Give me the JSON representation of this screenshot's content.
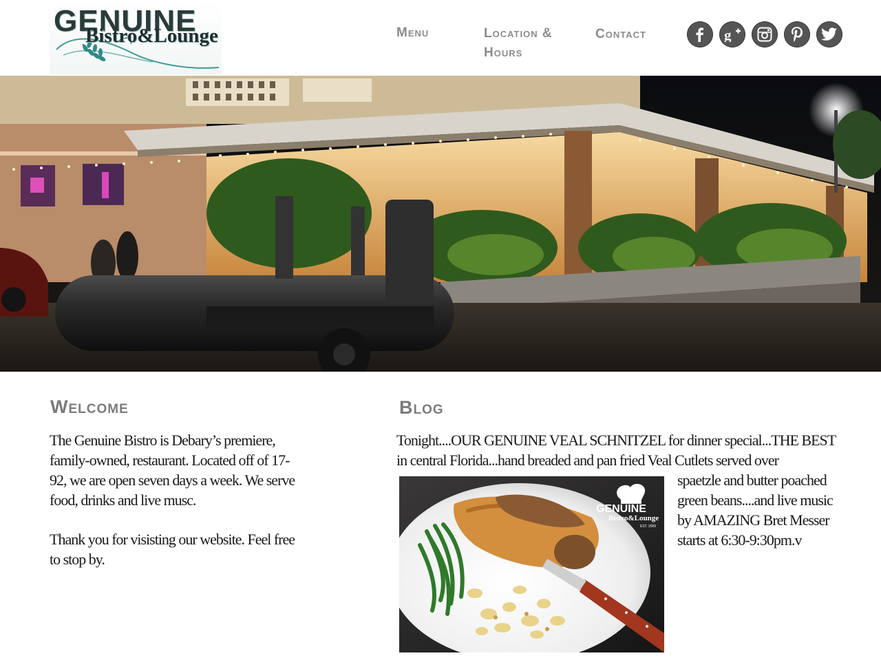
{
  "brand": {
    "logo_word1": "GENUINE",
    "logo_word2": "Bistro&Lounge",
    "accent_teal": "#2f8a86",
    "dark_teal": "#1f2f2f"
  },
  "nav": {
    "menu": "Menu",
    "location": "Location & Hours",
    "contact": "Contact"
  },
  "social": [
    {
      "icon": "facebook-icon"
    },
    {
      "icon": "google-plus-icon"
    },
    {
      "icon": "instagram-icon"
    },
    {
      "icon": "pinterest-icon"
    },
    {
      "icon": "twitter-icon"
    }
  ],
  "welcome": {
    "title": "Welcome",
    "p1": "The Genuine Bistro is Debary’s premiere, family-owned, restaurant. Located off of 17-92, we are open seven days a week. We serve food, drinks and live musc.",
    "p2": "Thank you for visisting our website. Feel free to stop by."
  },
  "blog": {
    "title": "Blog",
    "intro": "Tonight....OUR GENUINE VEAL SCHNITZEL for dinner special...THE BEST in central Florida...hand breaded and pan fried Veal Cutlets served over",
    "side": "spaetzle and butter poached green beans....and live music by AMAZING Bret Messer starts at 6:30-9:30pm.v",
    "photo_logo_word1": "GENUINE",
    "photo_logo_word2": "Bistro&Lounge",
    "photo_logo_est": "EST. 2009"
  }
}
